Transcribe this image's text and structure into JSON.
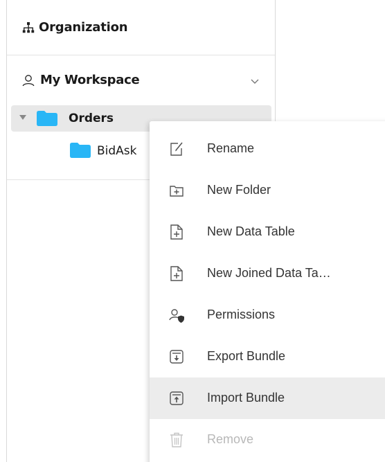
{
  "sidebar": {
    "organization": {
      "label": "Organization",
      "icon": "hierarchy-icon"
    },
    "workspace": {
      "label": "My Workspace",
      "icon": "user-icon",
      "expanded": true
    },
    "tree": [
      {
        "label": "Orders",
        "icon": "folder-icon",
        "expanded": true,
        "selected": true
      },
      {
        "label": "BidAsk",
        "icon": "folder-icon",
        "level": 2
      }
    ]
  },
  "context_menu": {
    "items": [
      {
        "label": "Rename",
        "icon": "rename-icon",
        "enabled": true
      },
      {
        "label": "New Folder",
        "icon": "new-folder-icon",
        "enabled": true
      },
      {
        "label": "New Data Table",
        "icon": "new-file-icon",
        "enabled": true
      },
      {
        "label": "New Joined Data Ta…",
        "icon": "new-file-icon",
        "enabled": true
      },
      {
        "label": "Permissions",
        "icon": "permissions-icon",
        "enabled": true
      },
      {
        "label": "Export Bundle",
        "icon": "export-icon",
        "enabled": true
      },
      {
        "label": "Import Bundle",
        "icon": "import-icon",
        "enabled": true,
        "hovered": true
      },
      {
        "label": "Remove",
        "icon": "trash-icon",
        "enabled": false
      }
    ]
  },
  "colors": {
    "folder": "#29b6f6",
    "selected_row": "#e8e8e8",
    "hover_row": "#ececec",
    "disabled_text": "#b8b8b8"
  }
}
